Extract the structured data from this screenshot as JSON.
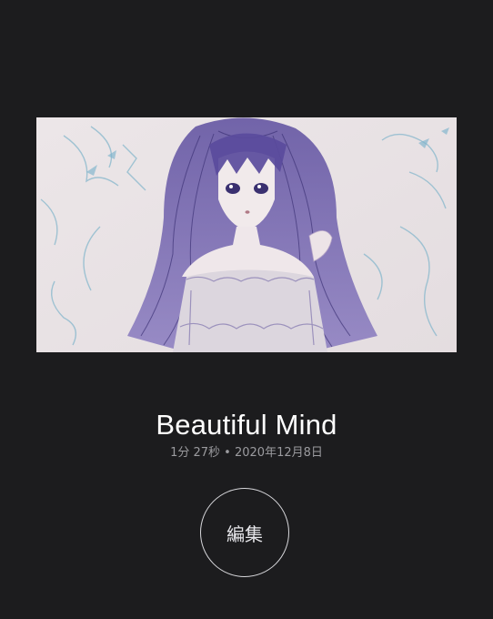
{
  "artwork": {
    "alt": "Pencil sketch of a girl with long purple hair",
    "palette": {
      "paper": "#eae4e6",
      "hair": "#6e5aa8",
      "hair_dark": "#3f3478",
      "sketch_blue": "#7fb3c9",
      "background": "#1c1c1e"
    }
  },
  "track": {
    "title": "Beautiful Mind",
    "meta": "1分 27秒 • 2020年12月8日"
  },
  "actions": {
    "edit_label": "編集"
  }
}
